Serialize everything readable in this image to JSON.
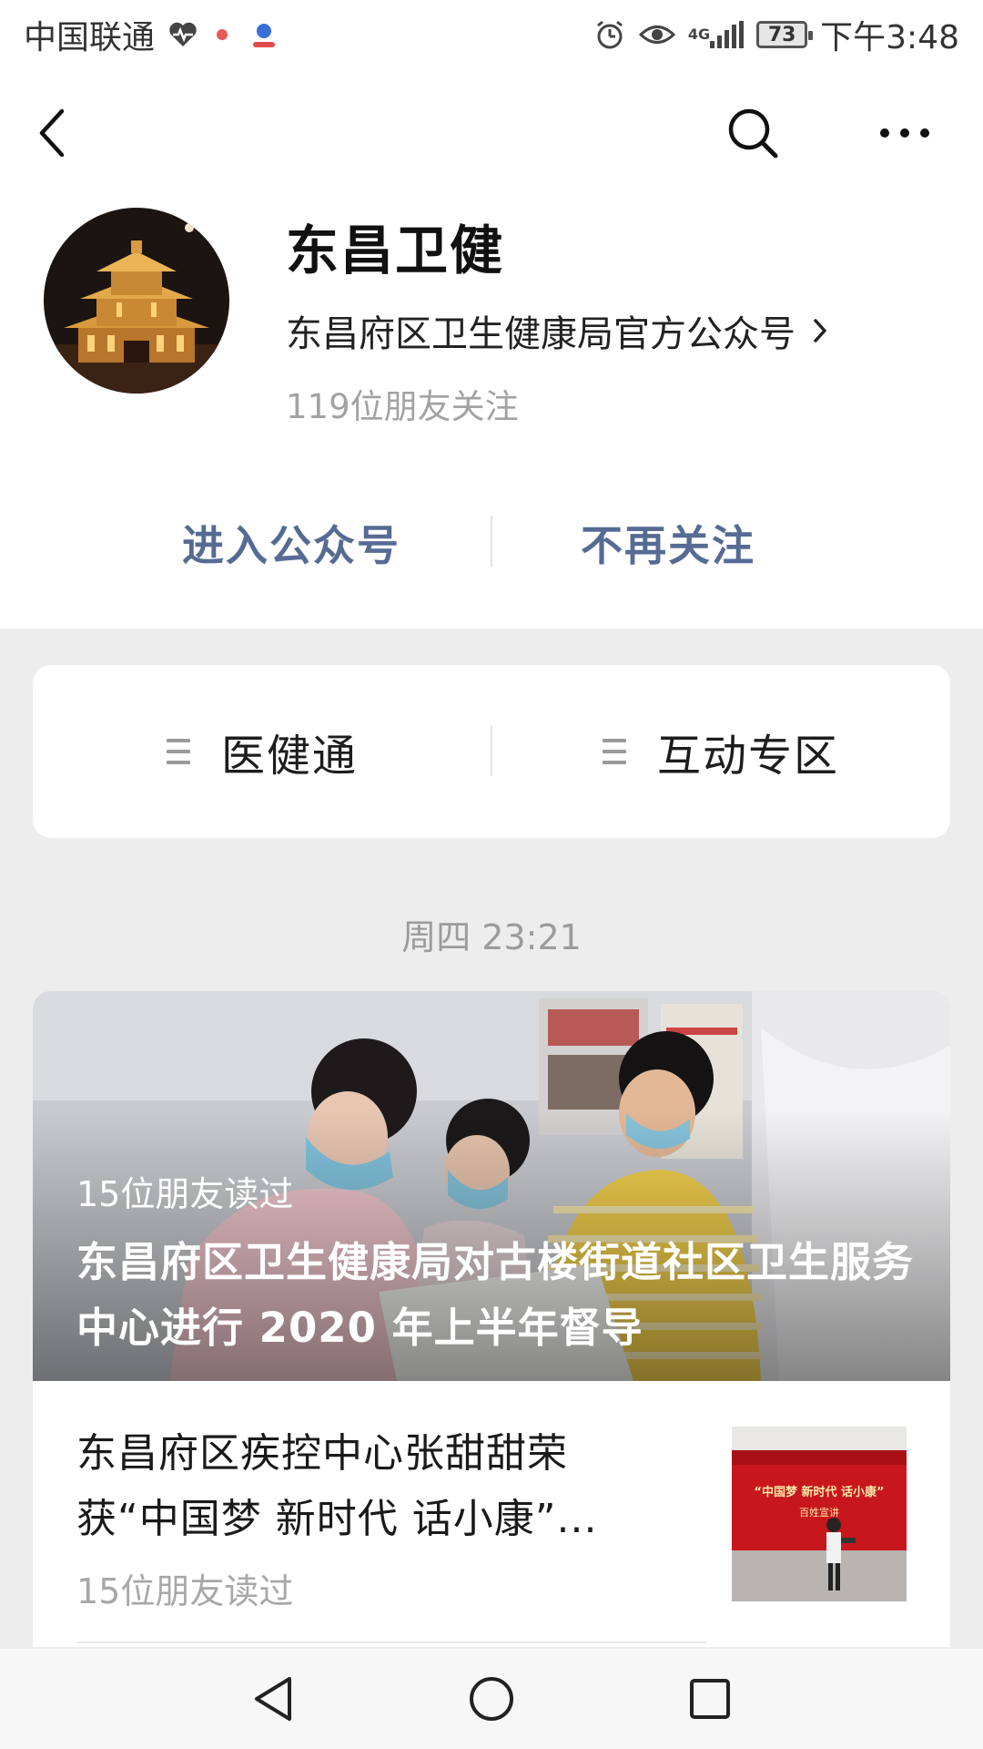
{
  "status_bar": {
    "carrier": "中国联通",
    "network": "4G",
    "battery": "73",
    "time": "下午3:48"
  },
  "account": {
    "name": "东昌卫健",
    "description": "东昌府区卫生健康局官方公众号",
    "followers": "119位朋友关注",
    "enter_label": "进入公众号",
    "unfollow_label": "不再关注"
  },
  "menu": {
    "items": [
      {
        "label": "医健通"
      },
      {
        "label": "互动专区"
      }
    ]
  },
  "feed": {
    "timestamp": "周四 23:21",
    "hero": {
      "reads": "15位朋友读过",
      "title": "东昌府区卫生健康局对古楼街道社区卫生服务中心进行 2020 年上半年督导"
    },
    "second": {
      "title": "东昌府区疾控中心张甜甜荣获“中国梦 新时代 话小康”...",
      "reads": "15位朋友读过",
      "thumb_text_1": "“中国梦 新时代 话小康”",
      "thumb_text_2": "百姓宣讲"
    }
  },
  "icons": {
    "back": "back-arrow-icon",
    "search": "search-icon",
    "more": "more-dots-icon",
    "menu": "menu-lines-icon",
    "chevron": "chevron-right-icon"
  },
  "colors": {
    "link_blue": "#566b94",
    "muted_gray": "#a2a2a2",
    "page_bg": "#ededed"
  }
}
